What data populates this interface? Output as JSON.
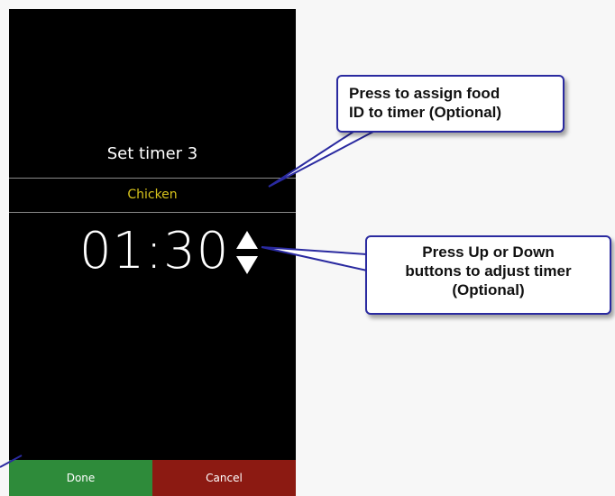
{
  "dialog": {
    "title": "Set timer 3",
    "food_id": "Chicken",
    "timer_value": "01:30",
    "done_label": "Done",
    "cancel_label": "Cancel"
  },
  "icons": {
    "up": "arrow-up-icon",
    "down": "arrow-down-icon"
  },
  "callouts": {
    "food_id_line1": "Press to assign food",
    "food_id_line2": "ID to timer (Optional)",
    "adjust_line1": "Press Up or Down",
    "adjust_line2": "buttons to adjust timer",
    "adjust_line3": "(Optional)"
  },
  "colors": {
    "food_id": "#d6c21c",
    "done": "#2e8b3a",
    "cancel": "#8c1a12",
    "callout_border": "#2a2aa0"
  }
}
